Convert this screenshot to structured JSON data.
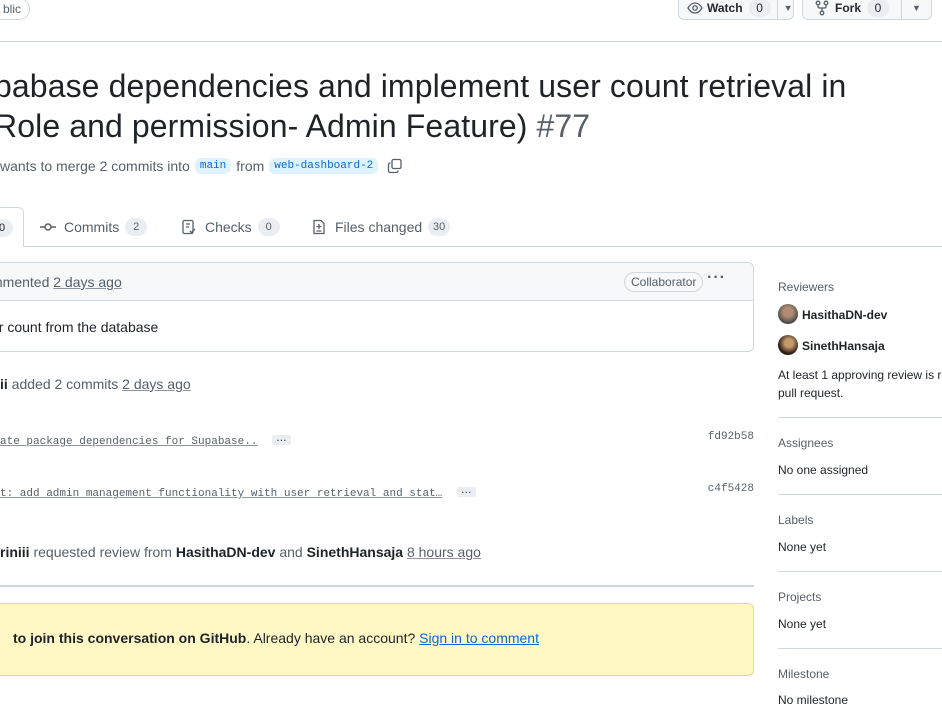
{
  "repo": {
    "visibility_badge": "blic"
  },
  "actions": {
    "watch_label": "Watch",
    "watch_count": "0",
    "fork_label": "Fork",
    "fork_count": "0"
  },
  "pr": {
    "title_line1": "pabase dependencies and implement user count retrieval in",
    "title_line2": "Role and permission- Admin Feature)",
    "number": "#77",
    "meta_prefix": "wants to merge 2 commits into",
    "base_branch": "main",
    "meta_from": "from",
    "head_branch": "web-dashboard-2"
  },
  "tabs": {
    "conversation_count": "0",
    "commits_label": "Commits",
    "commits_count": "2",
    "checks_label": "Checks",
    "checks_count": "0",
    "files_label": "Files changed",
    "files_count": "30"
  },
  "comment": {
    "action": "mmented",
    "time": "2 days ago",
    "role_badge": "Collaborator",
    "body": "er count from the database"
  },
  "timeline": {
    "added_user": "ii",
    "added_text": "added 2 commits",
    "added_time": "2 days ago",
    "commits": [
      {
        "message": "ate package dependencies for Supabase..",
        "sha": "fd92b58"
      },
      {
        "message": "t: add admin management functionality with user retrieval and stat…",
        "sha": "c4f5428"
      }
    ],
    "review_user": "riniii",
    "review_text": "requested review from",
    "reviewer1": "HasithaDN-dev",
    "review_and": "and",
    "reviewer2": "SinethHansaja",
    "review_time": "8 hours ago"
  },
  "signin_prompt": {
    "bold_text": "to join this conversation on GitHub",
    "mid_text": ". Already have an account?",
    "link_text": "Sign in to comment"
  },
  "sidebar": {
    "reviewers_title": "Reviewers",
    "reviewers": [
      "HasithaDN-dev",
      "SinethHansaja"
    ],
    "review_note_line1": "At least 1 approving review is r",
    "review_note_line2": "pull request.",
    "assignees_title": "Assignees",
    "assignees_value": "No one assigned",
    "labels_title": "Labels",
    "labels_value": "None yet",
    "projects_title": "Projects",
    "projects_value": "None yet",
    "milestone_title": "Milestone",
    "milestone_value": "No milestone"
  },
  "colors": {
    "accent": "#0969da",
    "success": "#1f883d",
    "notice_bg": "#fff8c5"
  }
}
